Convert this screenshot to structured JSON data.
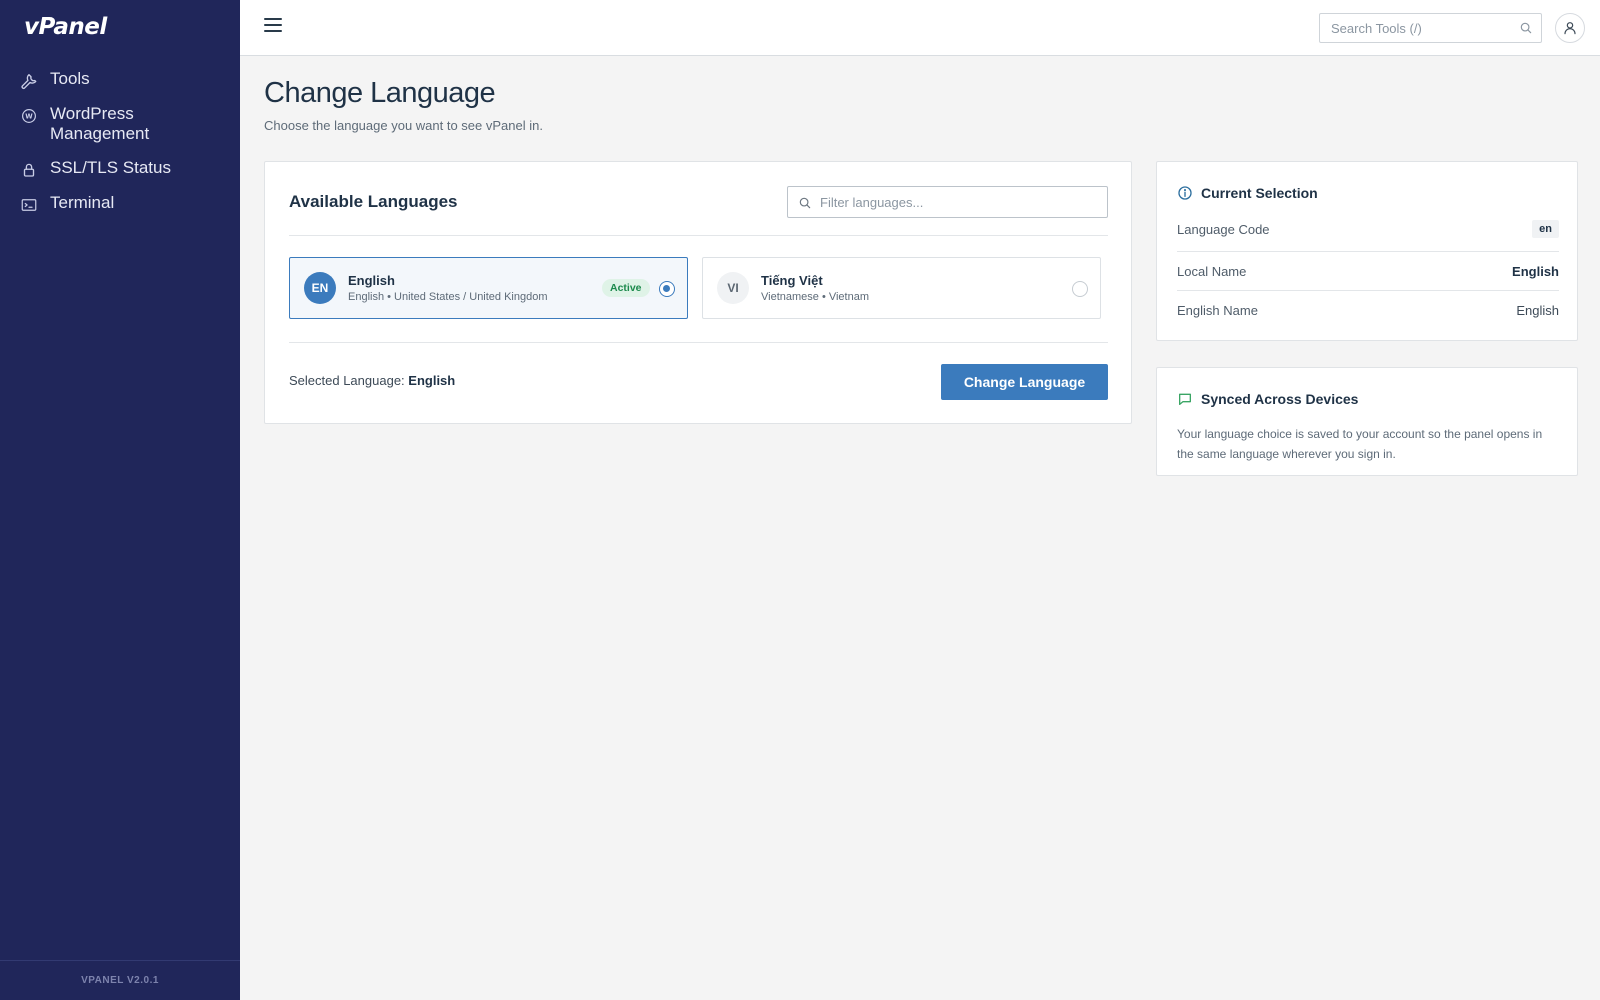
{
  "app": {
    "logo": "vPanel",
    "version": "VPANEL V2.0.1"
  },
  "sidebar": {
    "items": [
      {
        "label": "Tools",
        "icon": "wrench-icon"
      },
      {
        "label": "WordPress Management",
        "icon": "wordpress-icon"
      },
      {
        "label": "SSL/TLS Status",
        "icon": "lock-icon"
      },
      {
        "label": "Terminal",
        "icon": "terminal-icon"
      }
    ]
  },
  "topbar": {
    "search_placeholder": "Search Tools (/)"
  },
  "page": {
    "title": "Change Language",
    "subtitle": "Choose the language you want to see vPanel in."
  },
  "languages_card": {
    "title": "Available Languages",
    "filter_placeholder": "Filter languages...",
    "options": [
      {
        "code": "EN",
        "name": "English",
        "desc": "English • United States / United Kingdom",
        "badge": "Active",
        "selected": true
      },
      {
        "code": "VI",
        "name": "Tiếng Việt",
        "desc": "Vietnamese • Vietnam",
        "selected": false
      }
    ],
    "selected_label": "Selected Language:",
    "selected_value": "English",
    "button_label": "Change Language"
  },
  "current_selection": {
    "title": "Current Selection",
    "rows": [
      {
        "key": "Language Code",
        "value": "en"
      },
      {
        "key": "Local Name",
        "value": "English"
      },
      {
        "key": "English Name",
        "value": "English"
      }
    ]
  },
  "synced": {
    "title": "Synced Across Devices",
    "text": "Your language choice is saved to your account so the panel opens in the same language wherever you sign in."
  },
  "colors": {
    "sidebar_bg": "#20265a",
    "accent": "#3b7bbd",
    "active_badge_bg": "#dff3e7",
    "active_badge_text": "#1c8a4c",
    "info_icon": "#2c6e9e",
    "chat_icon": "#3aa564"
  }
}
